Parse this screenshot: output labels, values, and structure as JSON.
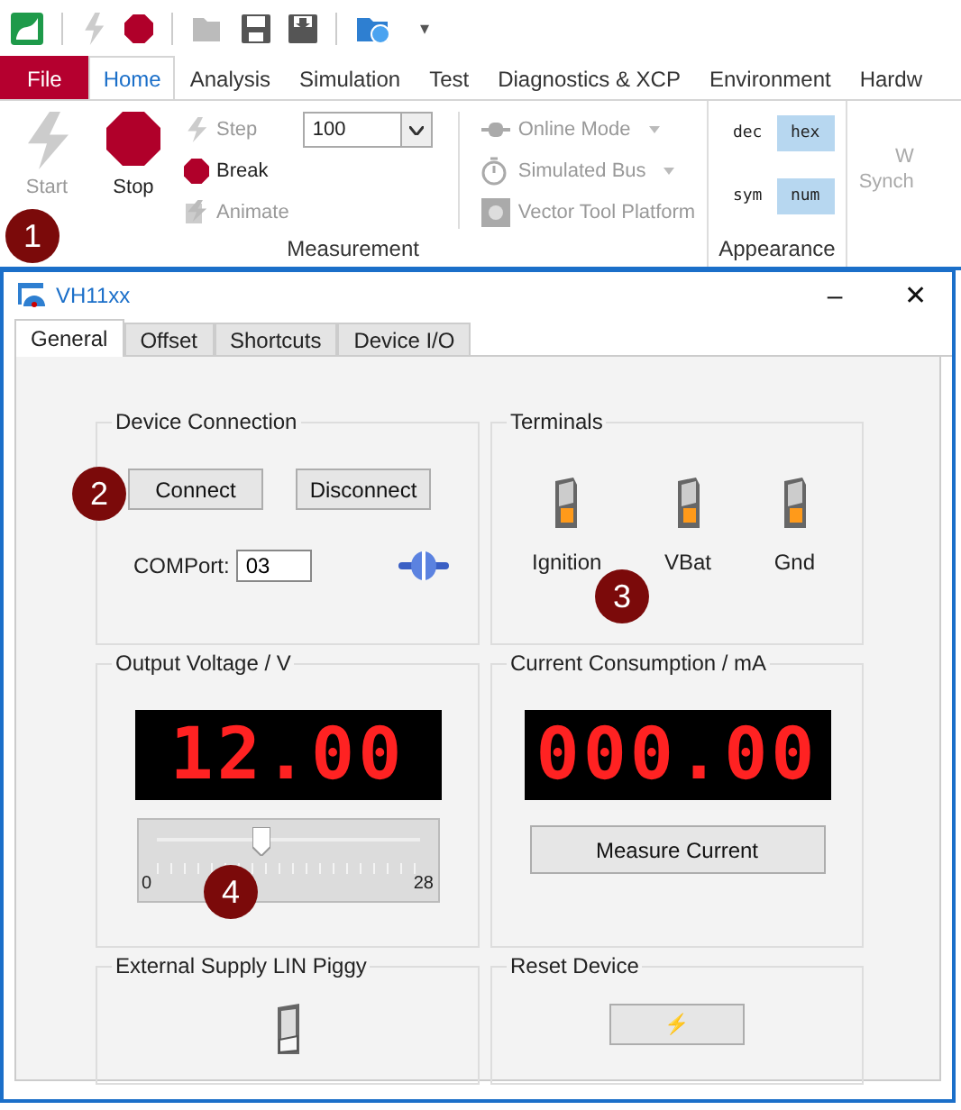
{
  "quick_access": {
    "items": [
      {
        "kind": "app"
      },
      {
        "kind": "start",
        "disabled": true
      },
      {
        "kind": "stop",
        "disabled": false
      },
      {
        "kind": "open",
        "disabled": true
      },
      {
        "kind": "save",
        "disabled": false
      },
      {
        "kind": "saveas",
        "disabled": false
      },
      {
        "kind": "folder",
        "disabled": false
      }
    ],
    "more": "▾"
  },
  "ribbon_tabs": [
    {
      "label": "File",
      "kind": "file",
      "selected": false
    },
    {
      "label": "Home",
      "kind": "tab",
      "selected": true
    },
    {
      "label": "Analysis",
      "kind": "tab",
      "selected": false
    },
    {
      "label": "Simulation",
      "kind": "tab",
      "selected": false
    },
    {
      "label": "Test",
      "kind": "tab",
      "selected": false
    },
    {
      "label": "Diagnostics & XCP",
      "kind": "tab",
      "selected": false
    },
    {
      "label": "Environment",
      "kind": "tab",
      "selected": false
    },
    {
      "label": "Hardw",
      "kind": "tab",
      "selected": false
    }
  ],
  "ribbon": {
    "big_buttons": [
      {
        "label": "Start",
        "kind": "start",
        "disabled": true
      },
      {
        "label": "Stop",
        "kind": "stop",
        "disabled": false
      }
    ],
    "small_buttons": [
      {
        "label": "Step",
        "kind": "step",
        "disabled": true
      },
      {
        "label": "Break",
        "kind": "break",
        "disabled": false
      },
      {
        "label": "Animate",
        "kind": "animate",
        "disabled": true
      }
    ],
    "speed_combo": {
      "value": "100"
    },
    "mode_buttons": [
      {
        "label": "Online Mode",
        "kind": "online",
        "disabled": true,
        "dropdown": true
      },
      {
        "label": "Simulated Bus",
        "kind": "simbus",
        "disabled": true,
        "dropdown": true
      },
      {
        "label": "Vector Tool Platform",
        "kind": "platform",
        "disabled": true,
        "dropdown": false
      }
    ],
    "measurement_label": "Measurement",
    "appearance": [
      {
        "label": "dec",
        "selected": false
      },
      {
        "label": "hex",
        "selected": true
      },
      {
        "label": "sym",
        "selected": false
      },
      {
        "label": "num",
        "selected": true
      }
    ],
    "appearance_label": "Appearance",
    "cut_button": {
      "line_1": "W",
      "line_2": "Synch"
    }
  },
  "window": {
    "title": "VH11xx",
    "minimize": "–",
    "close": "✕",
    "tabs": [
      {
        "label": "General",
        "selected": true
      },
      {
        "label": "Offset",
        "selected": false
      },
      {
        "label": "Shortcuts",
        "selected": false
      },
      {
        "label": "Device I/O",
        "selected": false
      }
    ],
    "device_connection": {
      "title": "Device Connection",
      "buttons": [
        "Connect",
        "Disconnect"
      ],
      "com_label": "COMPort:",
      "com_value": "03"
    },
    "terminals": {
      "title": "Terminals",
      "switches": [
        {
          "label": "Ignition",
          "on": false
        },
        {
          "label": "VBat",
          "on": false
        },
        {
          "label": "Gnd",
          "on": false
        }
      ]
    },
    "output_voltage": {
      "title": "Output Voltage / V",
      "display": "12.00",
      "slider": {
        "level": 0.4,
        "min": "0",
        "max": "28"
      }
    },
    "current": {
      "title": "Current Consumption / mA",
      "display": "000.00",
      "button": "Measure Current"
    },
    "external_supply": {
      "title": "External Supply LIN Piggy",
      "switch_on": true
    },
    "reset": {
      "title": "Reset Device",
      "button": "⚡"
    }
  },
  "callouts": [
    {
      "number": "1",
      "kind": "ribbon"
    },
    {
      "number": "2",
      "kind": "connect"
    },
    {
      "number": "3",
      "kind": "terminals"
    },
    {
      "number": "4",
      "kind": "slider"
    }
  ]
}
